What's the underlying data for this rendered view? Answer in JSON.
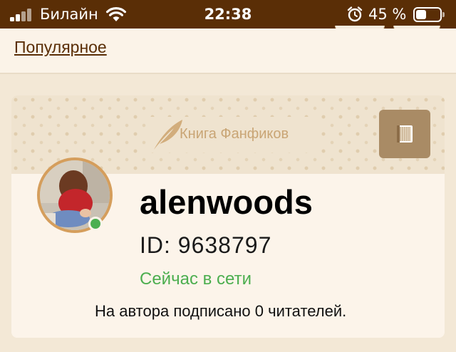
{
  "status_bar": {
    "carrier": "Билайн",
    "time": "22:38",
    "battery_percent": "45 %",
    "battery_level": 0.45,
    "icons": [
      "signal-icon",
      "wifi-icon",
      "alarm-icon",
      "battery-icon"
    ]
  },
  "nav": {
    "popular_link": "Популярное"
  },
  "banner": {
    "logo_text": "Книга Фанфиков",
    "icons": [
      "quill-icon",
      "book-icon"
    ]
  },
  "profile": {
    "username": "alenwoods",
    "id_label": "ID: 9638797",
    "online_status": "Сейчас в сети",
    "subscribers_text": "На автора подписано 0 читателей."
  },
  "colors": {
    "status_bar": "#5a2e06",
    "link": "#5a2e06",
    "online": "#4cae4f",
    "banner_button": "#a98b65",
    "avatar_border": "#d59e5c"
  }
}
